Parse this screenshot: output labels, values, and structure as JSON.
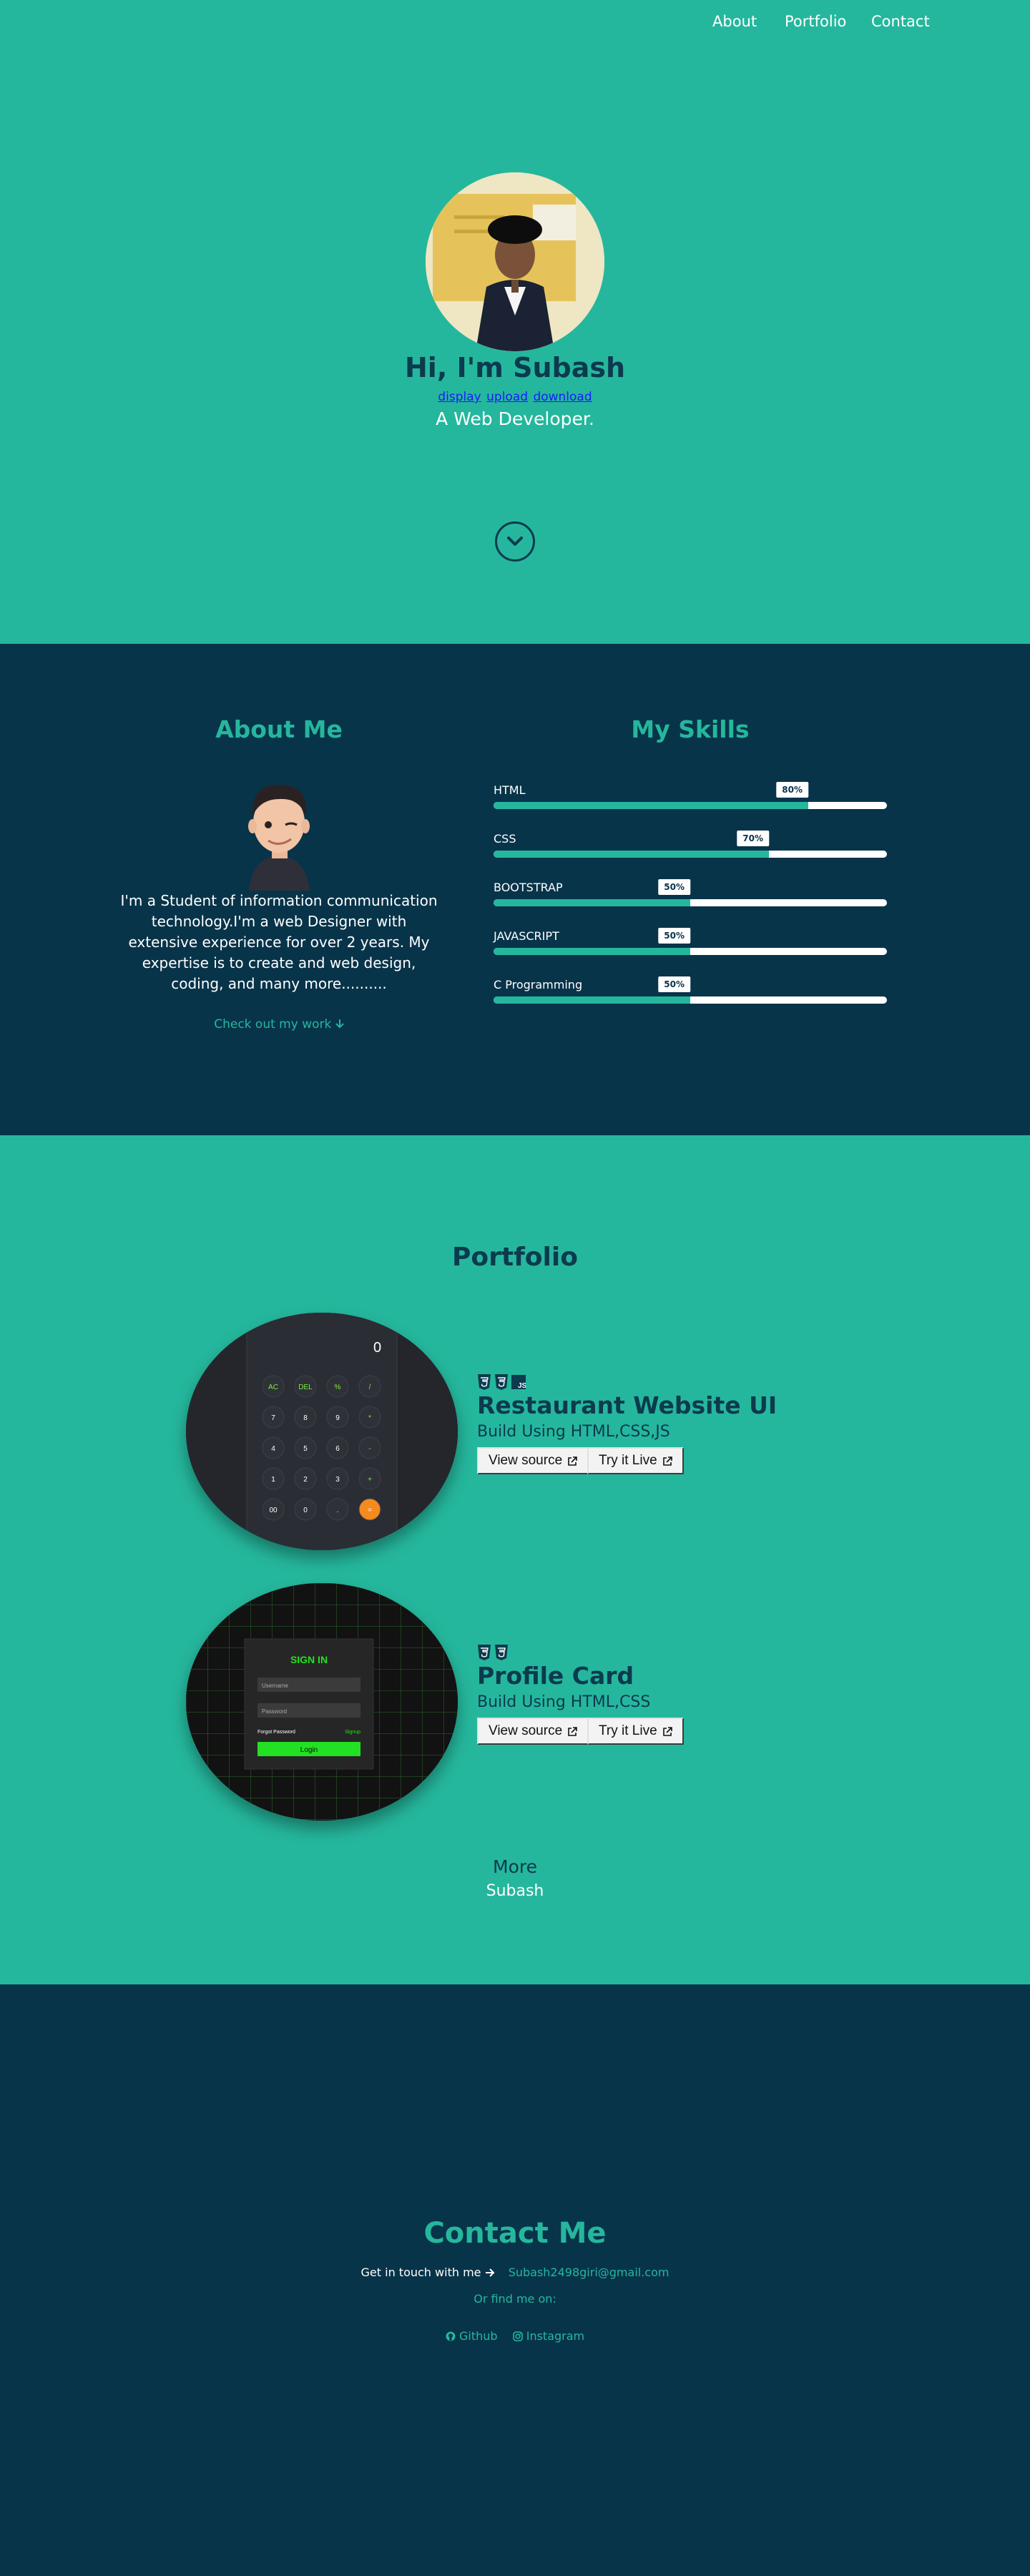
{
  "nav": {
    "about": "About",
    "portfolio": "Portfolio",
    "contact": "Contact"
  },
  "hero": {
    "name": "Hi, I'm Subash",
    "links": [
      "display",
      "upload",
      "download"
    ],
    "role": "A Web Developer."
  },
  "about": {
    "title": "About Me",
    "text": "I'm a Student of information communication technology.I'm a web Designer with extensive experience for over 2 years. My expertise is to create and web design, coding, and many more..........",
    "cta": "Check out my work"
  },
  "skills": {
    "title": "My Skills",
    "items": [
      {
        "label": "HTML",
        "percent": 80,
        "badge": "80%"
      },
      {
        "label": "CSS",
        "percent": 70,
        "badge": "70%"
      },
      {
        "label": "BOOTSTRAP",
        "percent": 50,
        "badge": "50%"
      },
      {
        "label": "JAVASCRIPT",
        "percent": 50,
        "badge": "50%"
      },
      {
        "label": "C Programming",
        "percent": 50,
        "badge": "50%"
      }
    ]
  },
  "portfolio": {
    "title": "Portfolio",
    "projects": [
      {
        "name": "Restaurant Website UI",
        "sub": "Build Using HTML,CSS,JS",
        "source": "View source",
        "live": "Try it Live",
        "calculator": {
          "display": "0",
          "keys": [
            "AC",
            "DEL",
            "%",
            "/",
            "7",
            "8",
            "9",
            "*",
            "4",
            "5",
            "6",
            "-",
            "1",
            "2",
            "3",
            "+",
            "00",
            "0",
            ".",
            "="
          ]
        }
      },
      {
        "name": "Profile Card",
        "sub": "Build Using HTML,CSS",
        "source": "View source",
        "live": "Try it Live",
        "login": {
          "title": "SIGN IN",
          "username": "Username",
          "password": "Password",
          "forgot": "Forgot Password",
          "signup": "Signup",
          "button": "Login"
        }
      }
    ],
    "more": "More",
    "more_sub": "Subash"
  },
  "contact": {
    "title": "Contact Me",
    "line": "Get in touch with me",
    "email": "Subash2498giri@gmail.com",
    "find": "Or find me on:",
    "github": "Github",
    "instagram": "Instagram"
  },
  "colors": {
    "teal": "#25b79d",
    "navy": "#08344a",
    "dark_text": "#0c3a4e"
  }
}
